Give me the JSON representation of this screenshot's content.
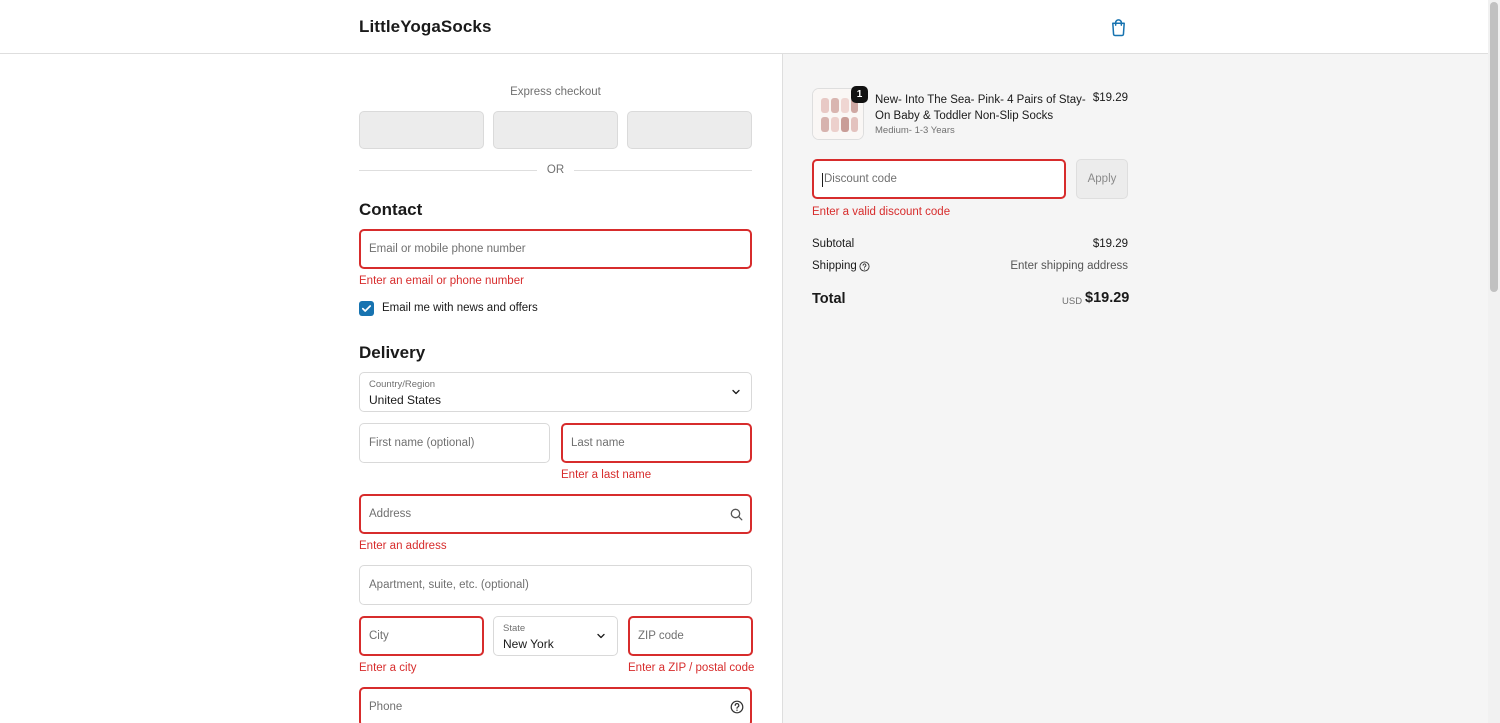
{
  "header": {
    "store_name": "LittleYogaSocks",
    "cart_icon": "shopping-bag-icon"
  },
  "express": {
    "label": "Express checkout",
    "buttons": [
      "",
      "",
      ""
    ],
    "divider": "OR"
  },
  "contact": {
    "title": "Contact",
    "email_placeholder": "Email or mobile phone number",
    "email_error": "Enter an email or phone number",
    "newsletter_label": "Email me with news and offers",
    "newsletter_checked": true
  },
  "delivery": {
    "title": "Delivery",
    "country_label": "Country/Region",
    "country_value": "United States",
    "first_name_placeholder": "First name (optional)",
    "last_name_placeholder": "Last name",
    "last_name_error": "Enter a last name",
    "address_placeholder": "Address",
    "address_error": "Enter an address",
    "apartment_placeholder": "Apartment, suite, etc. (optional)",
    "city_placeholder": "City",
    "city_error": "Enter a city",
    "state_label": "State",
    "state_value": "New York",
    "zip_placeholder": "ZIP code",
    "zip_error": "Enter a ZIP / postal code",
    "phone_placeholder": "Phone"
  },
  "summary": {
    "item": {
      "quantity": "1",
      "name": "New- Into The Sea- Pink- 4 Pairs of Stay-On Baby & Toddler Non-Slip Socks",
      "variant": "Medium- 1-3 Years",
      "price": "$19.29"
    },
    "discount_placeholder": "Discount code",
    "apply_label": "Apply",
    "discount_error": "Enter a valid discount code",
    "subtotal_label": "Subtotal",
    "subtotal_value": "$19.29",
    "shipping_label": "Shipping",
    "shipping_value": "Enter shipping address",
    "total_label": "Total",
    "currency": "USD",
    "total_value": "$19.29"
  },
  "colors": {
    "error": "#d72c2c",
    "accent": "#1773b0",
    "summary_bg": "#f5f5f5"
  }
}
